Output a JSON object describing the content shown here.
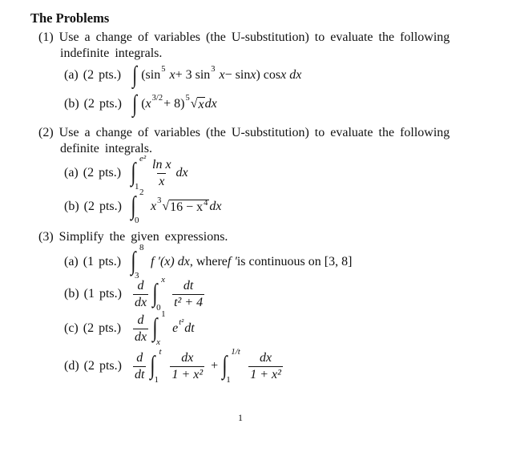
{
  "title": "The Problems",
  "p1": {
    "num": "(1)",
    "line1": "Use a change of variables (the U-substitution) to evaluate the following",
    "line2": "indefinite integrals.",
    "a": {
      "label": "(a)  (2 pts.)",
      "integral": "∫",
      "m1": "(sin",
      "e1": "5",
      "m2": "x",
      "m3": " + 3 sin",
      "e2": "3",
      "m4": "x",
      "m5": " − sin ",
      "m6": "x",
      "m7": ") cos ",
      "m8": "x dx"
    },
    "b": {
      "label": "(b)  (2 pts.)",
      "integral": "∫",
      "m1": "(",
      "m2": "x",
      "e1": "3/2",
      "m3": " + 8)",
      "e2": "5",
      "m4": "√",
      "m5": "x",
      "m6": " dx"
    }
  },
  "p2": {
    "num": "(2)",
    "line1": "Use a change of variables (the U-substitution) to evaluate the following",
    "line2": "definite integrals.",
    "a": {
      "label": "(a)  (2 pts.)",
      "integral": "∫",
      "hi": "e²",
      "lo": "1",
      "num": "ln x",
      "den": "x",
      "m1": "dx"
    },
    "b": {
      "label": "(b)  (2 pts.)",
      "integral": "∫",
      "hi": "2",
      "lo": "0",
      "m1": "x",
      "e1": "3",
      "m2": "√",
      "m3": "16 − x",
      "e2": "4",
      "m4": " dx"
    }
  },
  "p3": {
    "num": "(3)",
    "line1": "Simplify the given expressions.",
    "a": {
      "label": "(a)  (1 pts.)",
      "integral": "∫",
      "hi": "8",
      "lo": "3",
      "m1": "f ′(x) dx",
      "m2": ", where ",
      "m3": "f ′",
      "m4": " is continuous on [3, 8]"
    },
    "b": {
      "label": "(b)  (1 pts.)",
      "dn": "d",
      "dd": "dx",
      "integral": "∫",
      "hi": "x",
      "lo": "0",
      "num": "dt",
      "den": "t² + 4"
    },
    "c": {
      "label": "(c)  (2 pts.)",
      "dn": "d",
      "dd": "dx",
      "integral": "∫",
      "hi": "1",
      "lo": "x",
      "m1": "e",
      "e1": "t²",
      "m2": " dt"
    },
    "d": {
      "label": "(d)  (2 pts.)",
      "dn": "d",
      "dd": "dt",
      "integral": "∫",
      "hi": "t",
      "lo": "1",
      "num": "dx",
      "den": "1 + x²",
      "plus": "+",
      "hi2": "1/t",
      "lo2": "1",
      "num2": "dx",
      "den2": "1 + x²"
    }
  },
  "page_number": "1"
}
